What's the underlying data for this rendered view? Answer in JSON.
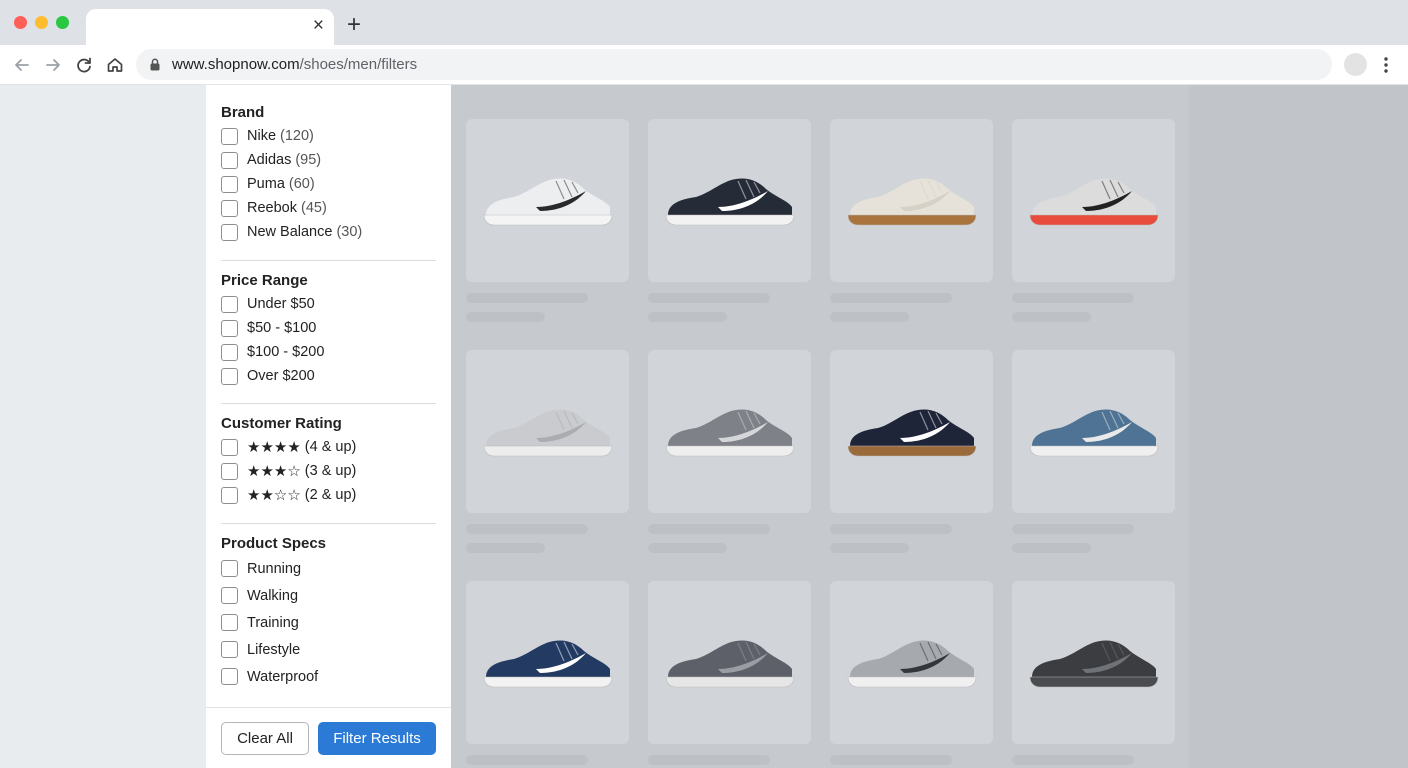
{
  "browser": {
    "url_host": "www.shopnow.com",
    "url_path": "/shoes/men/filters",
    "tab_close": "×",
    "new_tab": "+"
  },
  "filters": {
    "brand": {
      "title": "Brand",
      "options": [
        {
          "label": "Nike",
          "count": "(120)"
        },
        {
          "label": "Adidas",
          "count": "(95)"
        },
        {
          "label": "Puma",
          "count": "(60)"
        },
        {
          "label": "Reebok",
          "count": "(45)"
        },
        {
          "label": "New Balance",
          "count": "(30)"
        }
      ]
    },
    "price": {
      "title": "Price Range",
      "options": [
        "Under $50",
        "$50 - $100",
        "$100 - $200",
        "Over $200"
      ]
    },
    "rating": {
      "title": "Customer Rating",
      "options": [
        {
          "stars": "★★★★",
          "label": "(4 & up)"
        },
        {
          "stars": "★★★☆",
          "label": "(3 & up)"
        },
        {
          "stars": "★★☆☆",
          "label": "(2 & up)"
        }
      ]
    },
    "specs": {
      "title": "Product Specs",
      "options": [
        "Running",
        "Walking",
        "Training",
        "Lifestyle",
        "Waterproof"
      ]
    }
  },
  "footer": {
    "clear_label": "Clear All",
    "filter_label": "Filter Results",
    "accent_color": "#2b7bd6"
  },
  "products": [
    {
      "upper": "#eceef0",
      "sole": "#f4f4f4",
      "accent": "#2a2a2a"
    },
    {
      "upper": "#262b38",
      "sole": "#f2f2f2",
      "accent": "#ffffff"
    },
    {
      "upper": "#e6e2d9",
      "sole": "#a9743e",
      "accent": "#d6d1c6"
    },
    {
      "upper": "#dcdcdc",
      "sole": "#e74c3c",
      "accent": "#222222"
    },
    {
      "upper": "#c9cbce",
      "sole": "#ededed",
      "accent": "#a9acb0"
    },
    {
      "upper": "#7e8187",
      "sole": "#eeeeee",
      "accent": "#d4d6d9"
    },
    {
      "upper": "#1f2538",
      "sole": "#9a6a3a",
      "accent": "#ffffff"
    },
    {
      "upper": "#4f7394",
      "sole": "#f0f0f0",
      "accent": "#e9e9e9"
    },
    {
      "upper": "#233b63",
      "sole": "#f2f2f2",
      "accent": "#ffffff"
    },
    {
      "upper": "#5d6068",
      "sole": "#e6e6e6",
      "accent": "#9a9da3"
    },
    {
      "upper": "#a6a9ae",
      "sole": "#f0f0f0",
      "accent": "#33363b"
    },
    {
      "upper": "#3b3d40",
      "sole": "#4a4c4f",
      "accent": "#6f7276"
    }
  ]
}
